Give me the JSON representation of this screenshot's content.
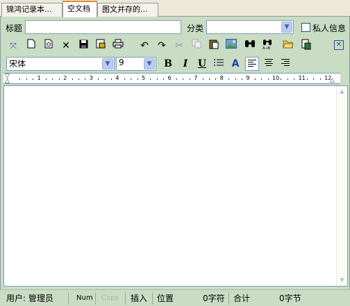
{
  "tabs": [
    {
      "label": "锦鸿记录本..."
    },
    {
      "label": "空文档"
    },
    {
      "label": "图文并存的..."
    }
  ],
  "form": {
    "title_label": "标题",
    "title_value": "",
    "category_label": "分类",
    "category_value": "",
    "private_label": "私人信息",
    "private_checked": false
  },
  "toolbar1": {
    "icons": [
      "fullscreen-icon",
      "new-document-icon",
      "refresh-icon",
      "delete-icon",
      "save-icon",
      "save-as-icon",
      "print-icon",
      "undo-icon",
      "redo-icon",
      "cut-icon",
      "copy-icon",
      "paste-icon",
      "insert-image-icon",
      "find-icon",
      "replace-icon",
      "open-folder-icon",
      "export-icon",
      "close-icon"
    ]
  },
  "toolbar2": {
    "font_name": "宋体",
    "font_size": "9",
    "bold_label": "B",
    "italic_label": "I",
    "underline_label": "U",
    "color_label": "A",
    "align": "left"
  },
  "ruler": {
    "numbers": [
      "1",
      "2",
      "3",
      "4",
      "5",
      "6",
      "7",
      "8",
      "9",
      "10",
      "11",
      "12"
    ]
  },
  "editor": {
    "content": ""
  },
  "statusbar": {
    "user": "用户: 管理员",
    "num": "Num",
    "caps": "Caps",
    "insert": "插入",
    "position": "位置",
    "chars": "0字符",
    "total": "合计",
    "bytes": "0字节"
  },
  "colors": {
    "panel_bg": "#c9dcc4",
    "tab_accent": "#e68b2c",
    "field_border": "#7f9db9"
  }
}
